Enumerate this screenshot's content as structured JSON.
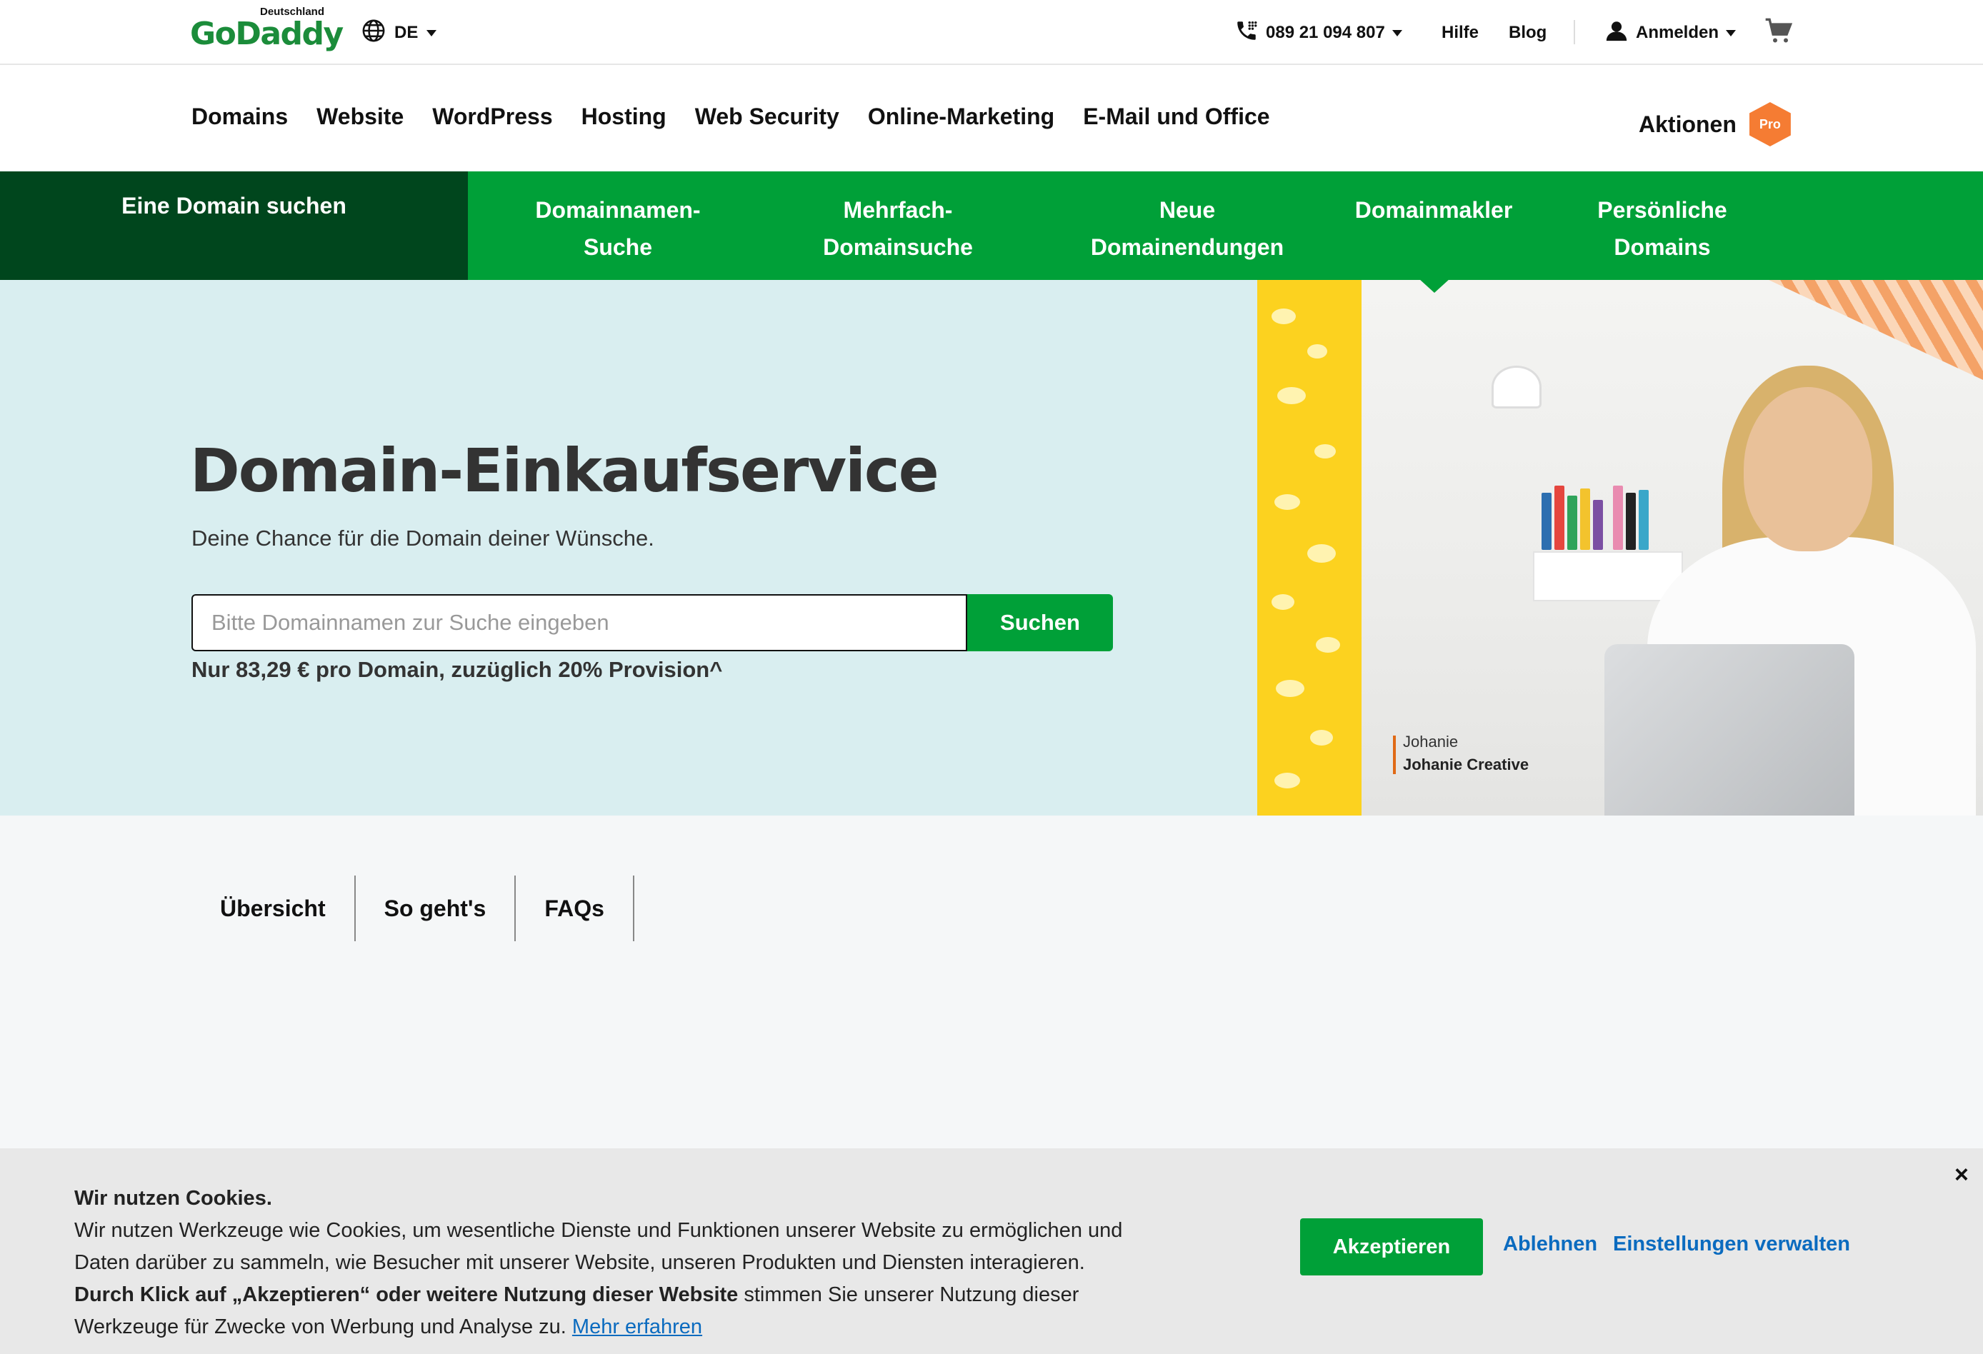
{
  "logo": {
    "country": "Deutschland",
    "wordmark": "GoDaddy"
  },
  "topbar": {
    "language": "DE",
    "phone": "089 21 094 807",
    "help": "Hilfe",
    "blog": "Blog",
    "signin": "Anmelden"
  },
  "mainnav": {
    "items": [
      "Domains",
      "Website",
      "WordPress",
      "Hosting",
      "Web Security",
      "Online-Marketing",
      "E-Mail und Office"
    ],
    "promo": "Aktionen",
    "pro_badge": "Pro"
  },
  "subnav": {
    "active": "Eine Domain suchen",
    "items": [
      {
        "line1": "Domainnamen-",
        "line2": "Suche"
      },
      {
        "line1": "Mehrfach-",
        "line2": "Domainsuche"
      },
      {
        "line1": "Neue",
        "line2": "Domainendungen"
      },
      {
        "line1": "Domainmakler",
        "line2": ""
      },
      {
        "line1": "Persönliche",
        "line2": "Domains"
      }
    ]
  },
  "hero": {
    "title": "Domain-Einkaufservice",
    "subtitle": "Deine Chance für die Domain deiner Wünsche.",
    "search_placeholder": "Bitte Domainnamen zur Suche eingeben",
    "search_value": "",
    "search_button": "Suchen",
    "price_note": "Nur 83,29 € pro Domain, zuzüglich 20% Provision^",
    "photo_caption_name": "Johanie",
    "photo_caption_company": "Johanie Creative"
  },
  "tabs": [
    "Übersicht",
    "So geht's",
    "FAQs"
  ],
  "cookie": {
    "title": "Wir nutzen Cookies.",
    "body1": "Wir nutzen Werkzeuge wie Cookies, um wesentliche Dienste und Funktionen unserer Website zu ermöglichen und Daten darüber zu sammeln, wie Besucher mit unserer Website, unseren Produkten und Diensten interagieren.",
    "bold": "Durch Klick auf „Akzeptieren“ oder weitere Nutzung dieser Website",
    "body2": " stimmen Sie unserer Nutzung dieser Werkzeuge für Zwecke von Werbung und Analyse zu.",
    "learn_more": "Mehr erfahren",
    "accept": "Akzeptieren",
    "reject": "Ablehnen",
    "settings": "Einstellungen verwalten",
    "close": "×"
  },
  "colors": {
    "brand_green": "#00a038",
    "dark_green": "#00461d",
    "hero_bg": "#d9eef0",
    "pro_orange": "#f57c33",
    "link_blue": "#0b6bbf"
  }
}
